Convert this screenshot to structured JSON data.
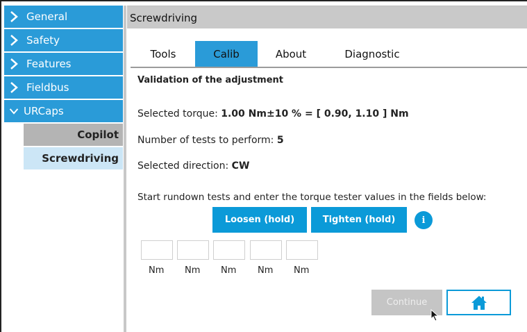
{
  "sidebar": {
    "items": [
      {
        "label": "General",
        "icon": "chevron-right-icon"
      },
      {
        "label": "Safety",
        "icon": "chevron-right-icon"
      },
      {
        "label": "Features",
        "icon": "chevron-right-icon"
      },
      {
        "label": "Fieldbus",
        "icon": "chevron-right-icon"
      },
      {
        "label": "URCaps",
        "icon": "chevron-down-icon"
      }
    ],
    "subitems": [
      {
        "label": "Copilot",
        "selected": false
      },
      {
        "label": "Screwdriving",
        "selected": true
      }
    ]
  },
  "header": {
    "title": "Screwdriving"
  },
  "tabs": [
    {
      "label": "Tools",
      "active": false
    },
    {
      "label": "Calib",
      "active": true
    },
    {
      "label": "About",
      "active": false
    },
    {
      "label": "Diagnostic",
      "active": false
    }
  ],
  "main": {
    "section_title": "Validation of the adjustment",
    "torque_label": "Selected torque:",
    "torque_value": "1.00 Nm±10 % = [ 0.90,  1.10 ] Nm",
    "tests_label": "Number of tests to perform:",
    "tests_value": "5",
    "direction_label": "Selected direction:",
    "direction_value": "CW",
    "instructions": "Start rundown tests and enter the torque tester values in the fields below:",
    "loosen_label": "Loosen (hold)",
    "tighten_label": "Tighten (hold)",
    "info_icon": "info-icon",
    "unit_labels": [
      "Nm",
      "Nm",
      "Nm",
      "Nm",
      "Nm"
    ],
    "continue_label": "Continue",
    "home_icon": "home-icon"
  },
  "colors": {
    "accent": "#2a9bd8",
    "button": "#0b9ad8",
    "selected_subitem": "#cce6f6",
    "unselected_subitem": "#b4b4b4",
    "header_bg": "#c9c9c9",
    "disabled_button": "#c5c5c5"
  }
}
